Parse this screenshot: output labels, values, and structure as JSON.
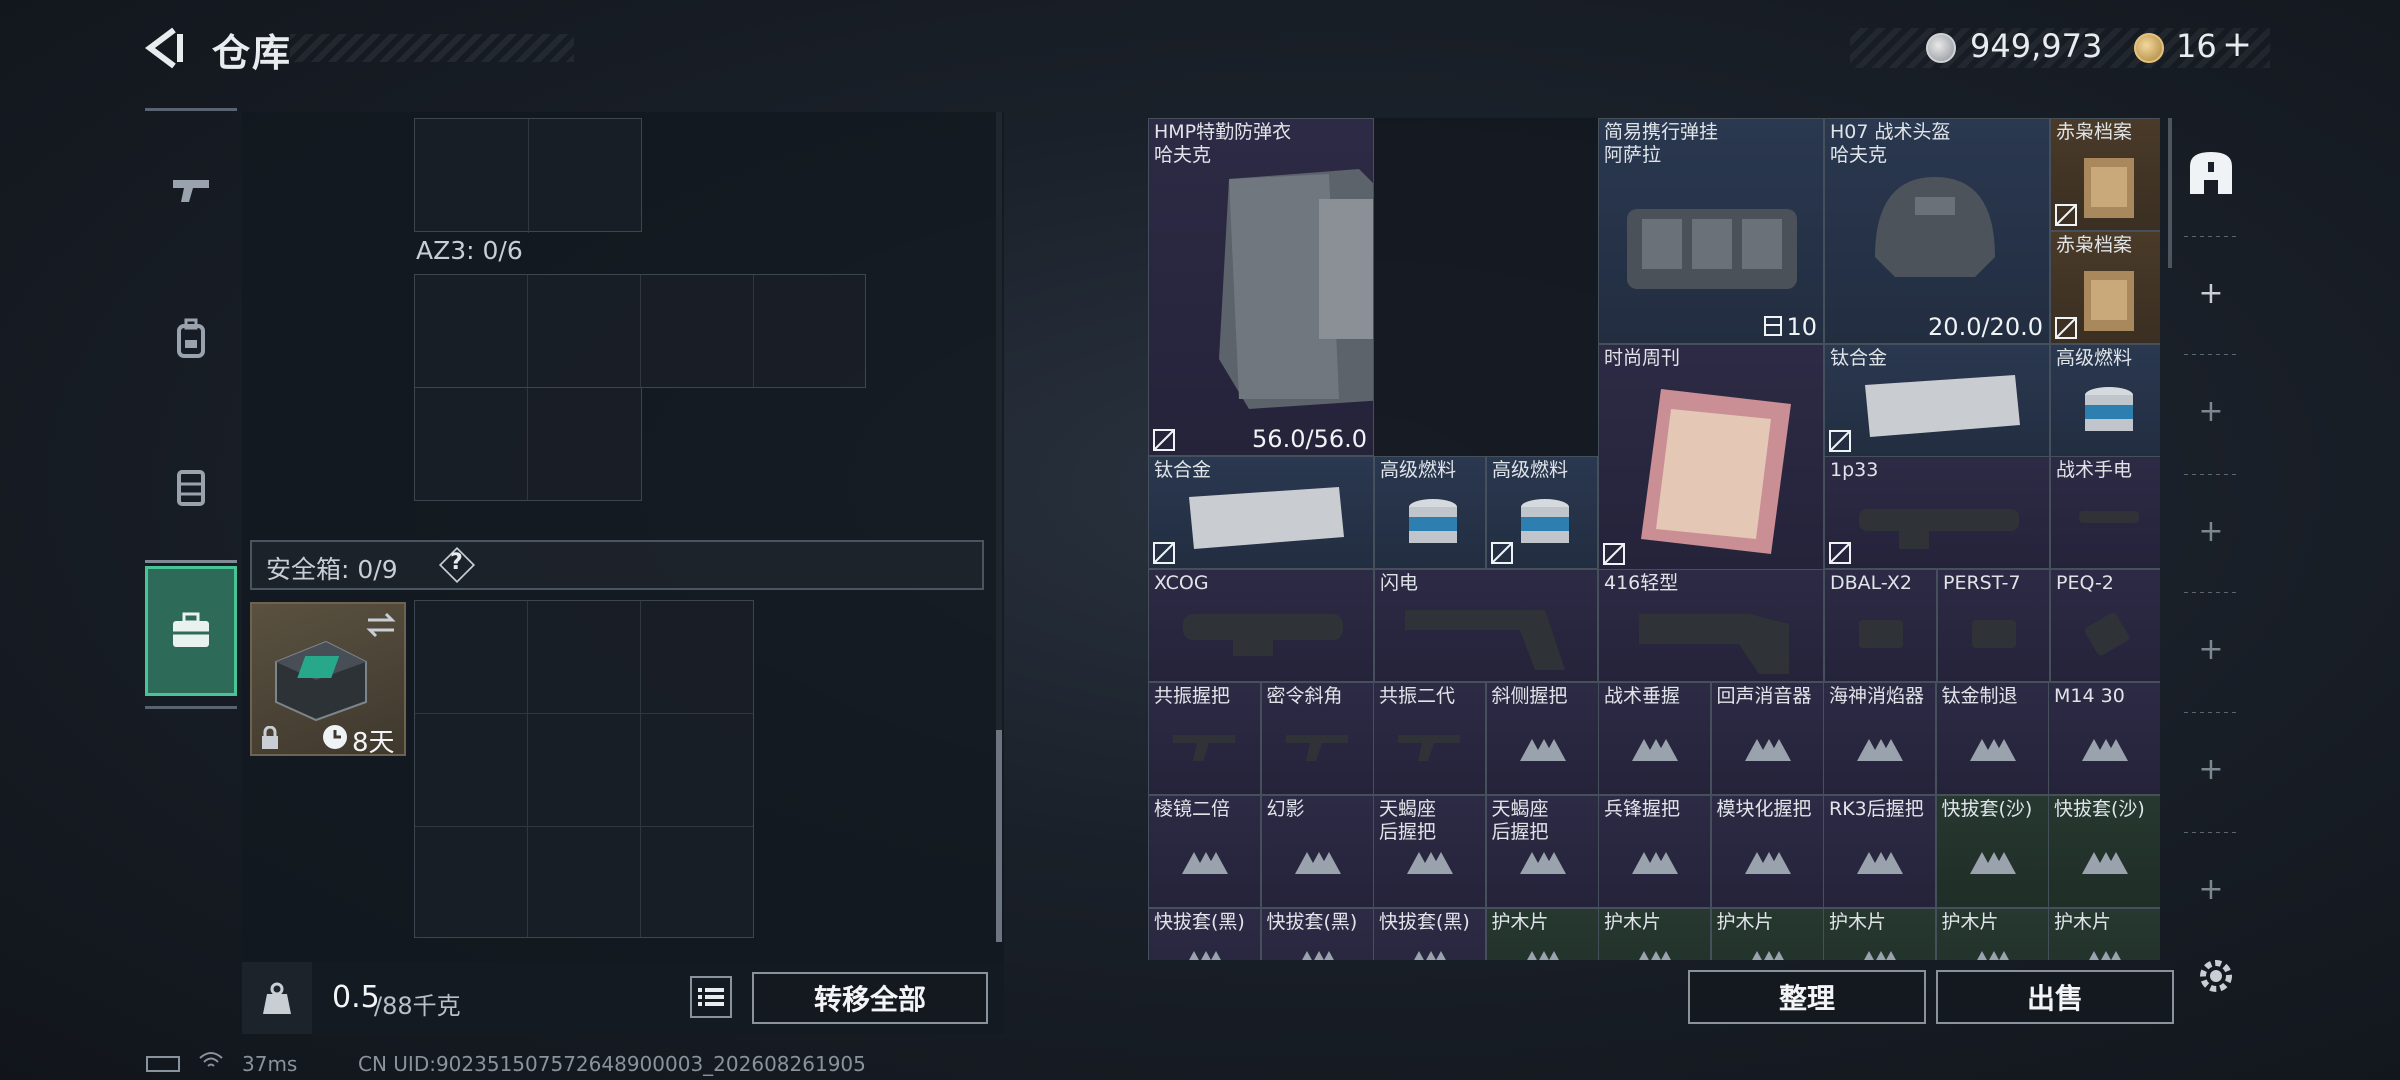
{
  "header": {
    "title": "仓库",
    "currency_silver": "949,973",
    "currency_gold": "16",
    "plus": "+"
  },
  "left": {
    "az3_label": "AZ3: 0/6",
    "safe_label": "安全箱: 0/9",
    "help": "?",
    "safebox_days": "8天",
    "weight_value": "0.5",
    "weight_max": "/88千克",
    "transfer_all": "转移全部"
  },
  "inventory": {
    "vest_name": "HMP特勤防弹衣",
    "vest_maker": "哈夫克",
    "vest_dur": "56.0/56.0",
    "rig_name": "简易携行弹挂",
    "rig_maker": "阿萨拉",
    "rig_count": "10",
    "helmet_name": "H07 战术头盔",
    "helmet_maker": "哈夫克",
    "helmet_dur": "20.0/20.0",
    "file1": "赤枭档案",
    "file2": "赤枭档案",
    "magazine": "时尚周刊",
    "titanium1": "钛合金",
    "fuel1": "高级燃料",
    "titanium2": "钛合金",
    "fuel2": "高级燃料",
    "fuel3": "高级燃料",
    "scope_1p33": "1p33",
    "flashlight": "战术手电",
    "xcog": "XCOG",
    "shandian": "闪电",
    "stock416": "416轻型",
    "dbal": "DBAL-X2",
    "perst": "PERST-7",
    "peq": "PEQ-2",
    "r4": [
      "共振握把",
      "密令斜角",
      "共振二代",
      "斜侧握把",
      "战术垂握",
      "回声消音器",
      "海神消焰器",
      "钛金制退",
      "M14 30"
    ],
    "r5": [
      "棱镜二倍",
      "幻影",
      "天蝎座\n后握把",
      "天蝎座\n后握把",
      "兵锋握把",
      "模块化握把",
      "RK3后握把",
      "快拔套(沙)",
      "快拔套(沙)"
    ],
    "r6": [
      "快拔套(黑)",
      "快拔套(黑)",
      "快拔套(黑)",
      "护木片",
      "护木片",
      "护木片",
      "护木片",
      "护木片",
      "护木片"
    ]
  },
  "actions": {
    "organize": "整理",
    "sell": "出售"
  },
  "status": {
    "ping": "37ms",
    "uid": "CN UID:902351507572648900003_202608261905"
  }
}
